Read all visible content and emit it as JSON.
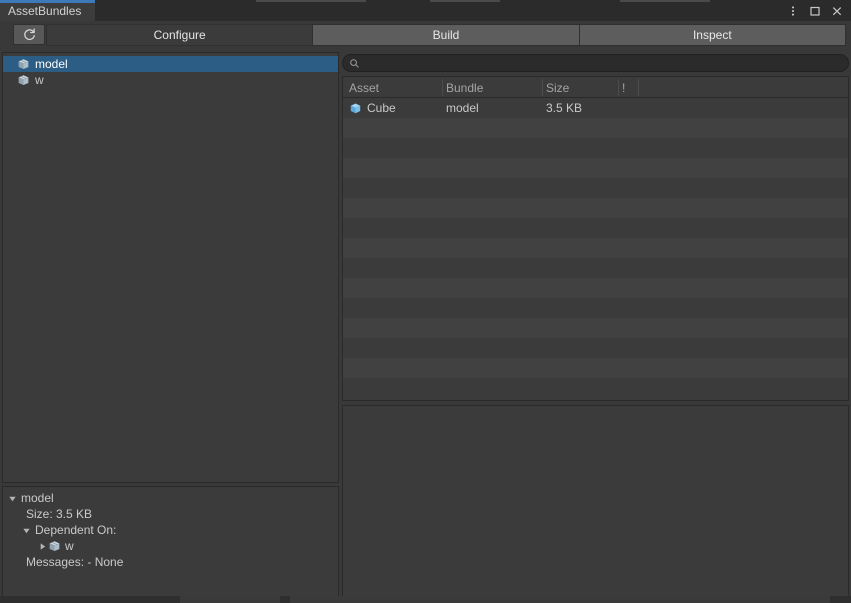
{
  "window": {
    "tab_title": "AssetBundles",
    "controls": {
      "menu": "kebab-menu",
      "maximize": "maximize",
      "close": "close"
    }
  },
  "toolbar": {
    "refresh_label": "Refresh",
    "tabs": [
      {
        "label": "Configure",
        "active": true
      },
      {
        "label": "Build",
        "active": false
      },
      {
        "label": "Inspect",
        "active": false
      }
    ]
  },
  "bundle_tree": {
    "items": [
      {
        "label": "model",
        "icon": "bundle-icon",
        "selected": true
      },
      {
        "label": "w",
        "icon": "bundle-icon",
        "selected": false
      }
    ]
  },
  "search": {
    "value": "",
    "placeholder": "",
    "icon": "search-icon"
  },
  "asset_list": {
    "columns": [
      {
        "key": "asset",
        "label": "Asset"
      },
      {
        "key": "bundle",
        "label": "Bundle"
      },
      {
        "key": "size",
        "label": "Size"
      },
      {
        "key": "flag",
        "label": "!"
      }
    ],
    "rows": [
      {
        "asset": "Cube",
        "bundle": "model",
        "size": "3.5 KB",
        "flag": "",
        "icon": "cube-icon"
      }
    ],
    "empty_row_count": 14
  },
  "detail": {
    "rows": [
      {
        "indent": 0,
        "arrow": "down",
        "label": "model",
        "icon": null
      },
      {
        "indent": 1,
        "arrow": null,
        "label": "Size: 3.5 KB",
        "icon": null
      },
      {
        "indent": 2,
        "arrow": "down",
        "label": "Dependent On:",
        "icon": null
      },
      {
        "indent": 3,
        "arrow": "right",
        "label": "w",
        "icon": "bundle-icon"
      },
      {
        "indent": 1,
        "arrow": null,
        "label": "Messages: - None",
        "icon": null
      }
    ]
  },
  "colors": {
    "accent_blue": "#3c79b8",
    "selection_blue": "#2c5d84",
    "panel_bg": "#3b3b3b",
    "window_bg": "#393939",
    "cube_blue": "#70bdf0"
  }
}
